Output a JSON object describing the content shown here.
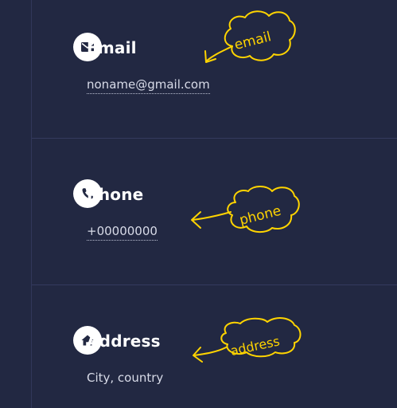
{
  "contacts": {
    "email": {
      "title": "Email",
      "value": "noname@gmail.com",
      "icon": "envelope-icon",
      "annotation": "email"
    },
    "phone": {
      "title": "Phone",
      "value": "+00000000",
      "icon": "phone-icon",
      "annotation": "phone"
    },
    "address": {
      "title": "Address",
      "value": "City, country",
      "icon": "home-icon",
      "annotation": "address"
    }
  },
  "colors": {
    "background": "#222842",
    "divider": "#343a5e",
    "title": "#ffffff",
    "value": "#d8dbe8",
    "annotation": "#ffd400"
  }
}
